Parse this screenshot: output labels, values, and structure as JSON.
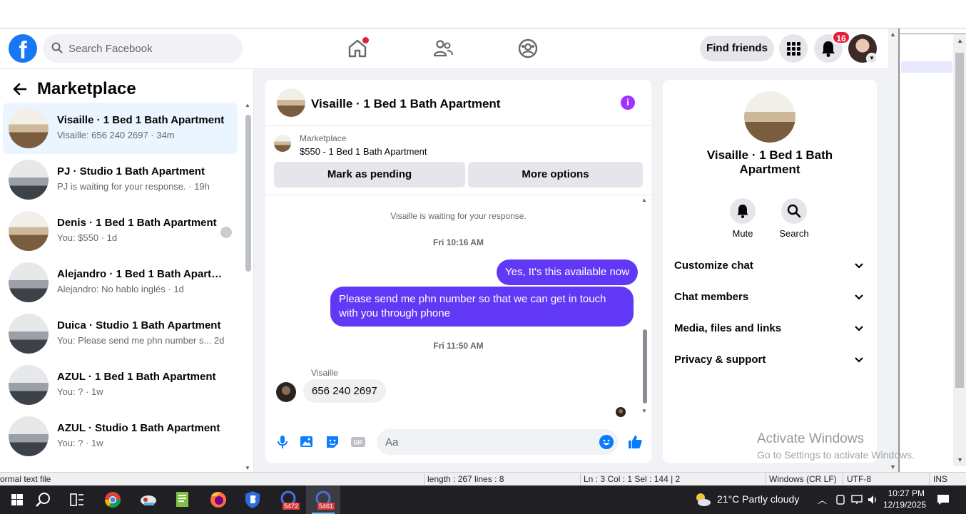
{
  "nav": {
    "logo": "f",
    "search_placeholder": "Search Facebook",
    "find_friends": "Find friends",
    "notifications_count": "16"
  },
  "left": {
    "title": "Marketplace",
    "conversations": [
      {
        "title": "Visaille · 1 Bed 1 Bath Apartment",
        "subtitle": "Visaille: 656 240 2697 · 34m"
      },
      {
        "title": "PJ · Studio 1 Bath Apartment",
        "subtitle": "PJ is waiting for your response. · 19h"
      },
      {
        "title": "Denis · 1 Bed 1 Bath Apartment",
        "subtitle": "You: $550 · 1d"
      },
      {
        "title": "Alejandro · 1 Bed 1 Bath Apartm...",
        "subtitle": "Alejandro: No hablo inglés · 1d"
      },
      {
        "title": "Duica · Studio 1 Bath Apartment",
        "subtitle": "You: Please send me phn number s...  2d"
      },
      {
        "title": "AZUL · 1 Bed 1 Bath Apartment",
        "subtitle": "You: ? · 1w"
      },
      {
        "title": "AZUL · Studio 1 Bath Apartment",
        "subtitle": "You: ? · 1w"
      }
    ]
  },
  "chat": {
    "title": "Visaille · 1 Bed 1 Bath Apartment",
    "marketplace_label": "Marketplace",
    "listing": "$550 - 1 Bed 1 Bath Apartment",
    "mark_pending": "Mark as pending",
    "more_options": "More options",
    "waiting_notice": "Visaille is waiting for your response.",
    "time1": "Fri 10:16 AM",
    "msg_out_1": "Yes, It's this available now",
    "msg_out_2": "Please send me  phn  number so that we can get in touch with you through phone",
    "time2": "Fri 11:50 AM",
    "sender_name": "Visaille",
    "msg_in_1": "656 240 2697",
    "composer_placeholder": "Aa"
  },
  "details": {
    "name": "Visaille · 1 Bed 1 Bath Apartment",
    "mute": "Mute",
    "search": "Search",
    "sections": [
      "Customize chat",
      "Chat members",
      "Media, files and links",
      "Privacy & support"
    ]
  },
  "watermark": {
    "line1": "Activate Windows",
    "line2": "Go to Settings to activate Windows."
  },
  "statusbar": {
    "file_type": "ormal text file",
    "length": "length : 267    lines : 8",
    "position": "Ln : 3    Col : 1    Sel : 144 | 2",
    "eol": "Windows (CR LF)",
    "encoding": "UTF-8",
    "mode": "INS"
  },
  "taskbar": {
    "badge_1": "5472",
    "badge_2": "5461",
    "weather": "21°C  Partly cloudy",
    "time": "10:27 PM",
    "date": "12/19/2025"
  },
  "colors": {
    "fb_blue": "#1877f2",
    "bubble_purple": "#6138f5",
    "info_purple": "#a033ff",
    "notif_red": "#e41e3f"
  }
}
